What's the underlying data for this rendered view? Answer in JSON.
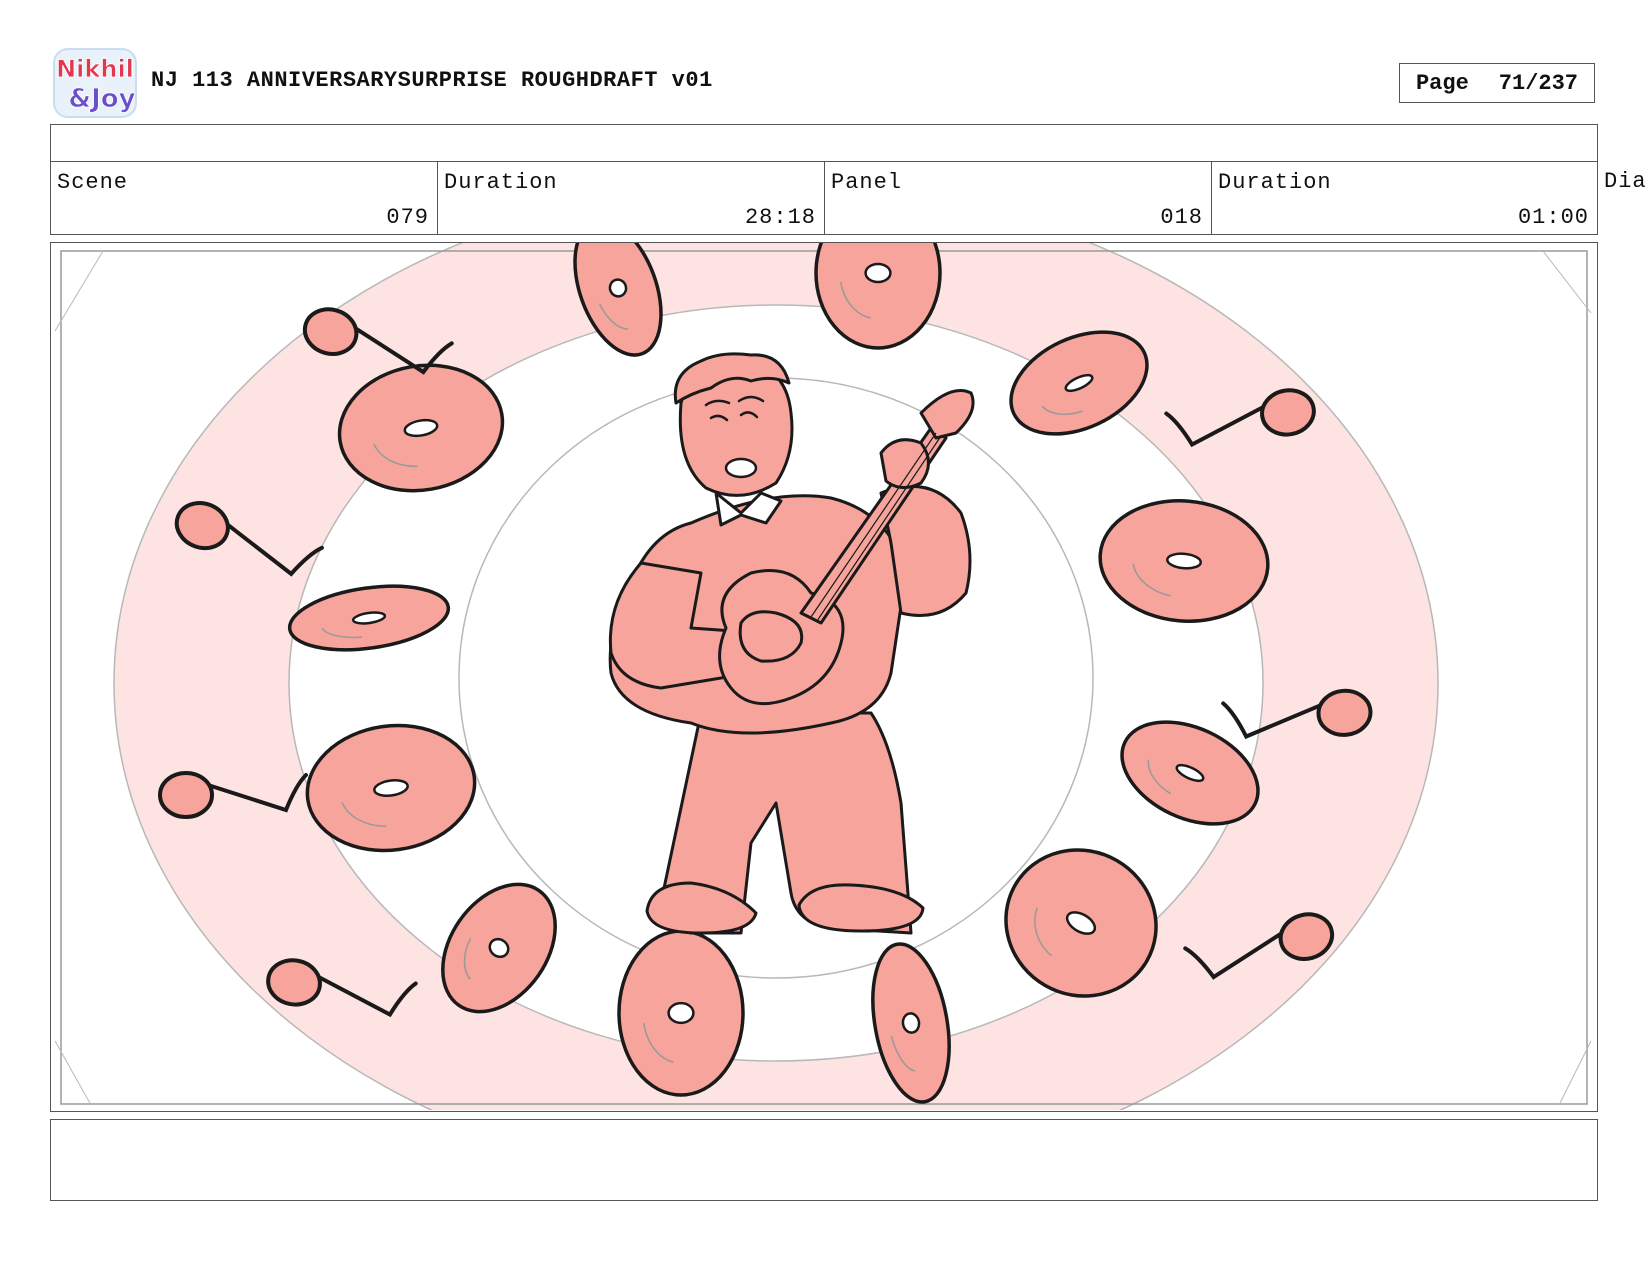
{
  "header": {
    "title": "NJ 113 ANNIVERSARYSURPRISE ROUGHDRAFT v01",
    "page_label": "Page",
    "page_number": "71/237",
    "logo_text_line1": "Nikhil",
    "logo_text_line2": "&Joy"
  },
  "meta": {
    "scene_label": "Scene",
    "scene_value": "079",
    "scene_duration_label": "Duration",
    "scene_duration_value": "28:18",
    "panel_label": "Panel",
    "panel_value": "018",
    "panel_duration_label": "Duration",
    "panel_duration_value": "01:00",
    "overflow_label": "Dia"
  },
  "panel": {
    "fill_color": "#f6a49c",
    "ring_color": "#fde4e2",
    "line_color": "#1a1a1a"
  },
  "notes": {
    "text": ""
  }
}
